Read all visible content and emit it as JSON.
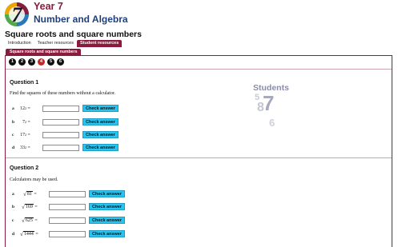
{
  "header": {
    "logo_digit": "7",
    "year": "Year 7",
    "strand": "Number and Algebra",
    "page_title": "Square roots and square numbers"
  },
  "tabs": [
    {
      "label": "Introduction",
      "active": false
    },
    {
      "label": "Teacher resources",
      "active": false
    },
    {
      "label": "Student resources",
      "active": true
    }
  ],
  "subtab": {
    "label": "Square roots and square numbers"
  },
  "steps": [
    {
      "label": "1",
      "current": false
    },
    {
      "label": "2",
      "current": false
    },
    {
      "label": "3",
      "current": false
    },
    {
      "label": "4",
      "current": true
    },
    {
      "label": "5",
      "current": false
    },
    {
      "label": "6",
      "current": false
    }
  ],
  "graphic": {
    "word": "Students",
    "digits": [
      "5",
      "7",
      "8",
      "6"
    ]
  },
  "question1": {
    "heading": "Question 1",
    "instruction": "Find the squares of these numbers without a calculator.",
    "items": [
      {
        "letter": "a",
        "base": "12",
        "exp": "2",
        "eq": "=",
        "value": "",
        "button": "Check answer"
      },
      {
        "letter": "b",
        "base": "7",
        "exp": "2",
        "eq": "=",
        "value": "",
        "button": "Check answer"
      },
      {
        "letter": "c",
        "base": "17",
        "exp": "2",
        "eq": "=",
        "value": "",
        "button": "Check answer"
      },
      {
        "letter": "d",
        "base": "33",
        "exp": "2",
        "eq": "=",
        "value": "",
        "button": "Check answer"
      }
    ]
  },
  "question2": {
    "heading": "Question 2",
    "instruction": "Calculators may be used.",
    "items": [
      {
        "letter": "a",
        "radicand": "81",
        "eq": "=",
        "value": "",
        "button": "Check answer"
      },
      {
        "letter": "b",
        "radicand": "169",
        "eq": "=",
        "value": "",
        "button": "Check answer"
      },
      {
        "letter": "c",
        "radicand": "625",
        "eq": "=",
        "value": "",
        "button": "Check answer"
      },
      {
        "letter": "d",
        "radicand": "1444",
        "eq": "=",
        "value": "",
        "button": "Check answer"
      }
    ]
  },
  "colors": {
    "brand": "#8a1b3c",
    "navy": "#1f3f7a",
    "button": "#2ac3ee",
    "current_step": "#c62828"
  }
}
